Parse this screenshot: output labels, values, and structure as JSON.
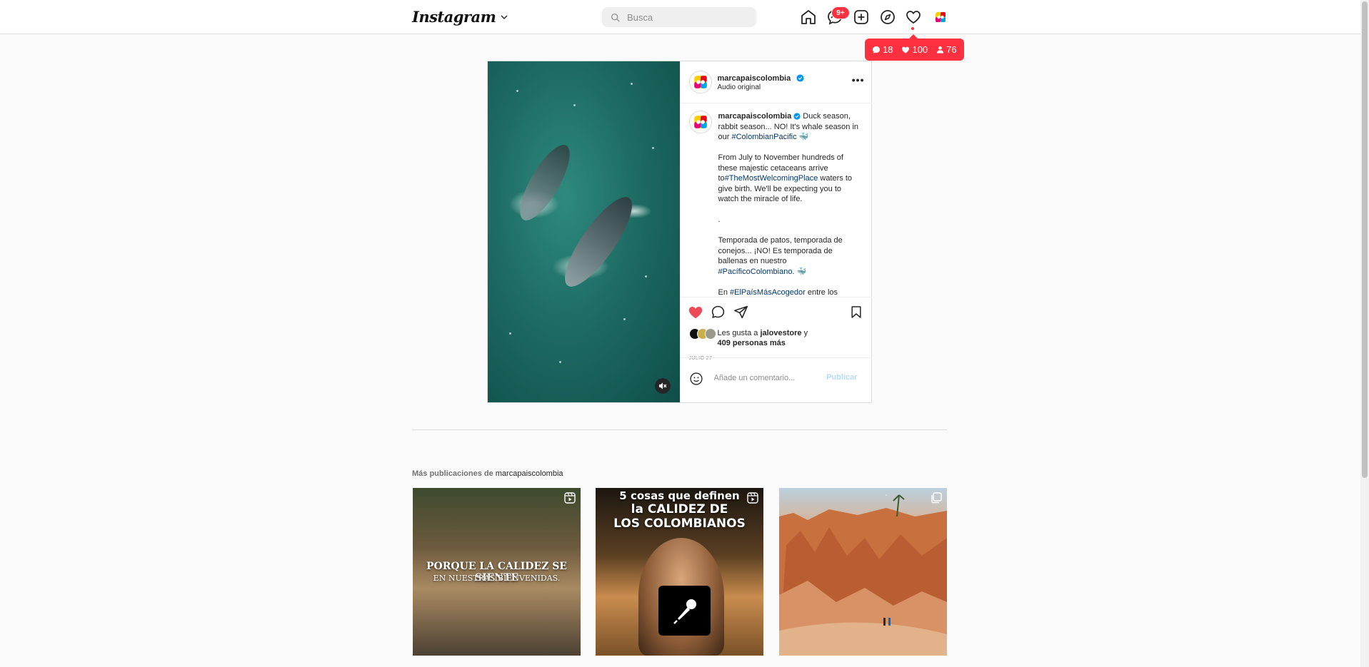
{
  "topbar": {
    "logo": "Instagram",
    "search_placeholder": "Busca",
    "messages_badge": "9+",
    "icons": [
      "home-icon",
      "messages-icon",
      "create-icon",
      "explore-icon",
      "notifications-heart-icon",
      "profile-avatar"
    ]
  },
  "notifications_popup": {
    "comments": "18",
    "likes": "100",
    "followers": "76",
    "color": "#ff3040"
  },
  "post": {
    "username": "marcapaiscolombia",
    "audio": "Audio original",
    "caption_parts": [
      {
        "t": "Duck season, rabbit season... NO! It's whale season in our ",
        "h": false
      },
      {
        "t": "#ColombianPacific",
        "h": true
      },
      {
        "t": " 🐳\n\nFrom July to November hundreds of these majestic cetaceans arrive to",
        "h": false
      },
      {
        "t": "#TheMostWelcomingPlace",
        "h": true
      },
      {
        "t": " waters to give birth. We'll be expecting you to watch the miracle of life.\n\n.\n\nTemporada de patos, temporada de conejos... ¡NO! Es temporada de ballenas en nuestro ",
        "h": false
      },
      {
        "t": "#PacíficoColombiano",
        "h": true
      },
      {
        "t": ". 🐳\n\nEn ",
        "h": false
      },
      {
        "t": "#ElPaísMásAcogedor",
        "h": true
      },
      {
        "t": " entre los",
        "h": false
      }
    ],
    "likes_prefix": "Les gusta a ",
    "likes_user": "jalovestore",
    "likes_and": " y",
    "likes_others": "409 personas más",
    "date": "JULIO 27",
    "comment_placeholder": "Añade un comentario...",
    "publish_label": "Publicar",
    "liked": true,
    "like_color": "#ed4956"
  },
  "more": {
    "title_prefix": "Más publicaciones de ",
    "title_user": "marcapaiscolombia",
    "thumbs": [
      {
        "type": "reel",
        "line1": "PORQUE LA CALIDEZ SE SIENTE",
        "line2": "EN NUESTRAS BIENVENIDAS."
      },
      {
        "type": "reel",
        "line1": "5 cosas que definen",
        "line2": "la CALIDEZ DE",
        "line3": "LOS COLOMBIANOS"
      },
      {
        "type": "carousel"
      }
    ]
  }
}
